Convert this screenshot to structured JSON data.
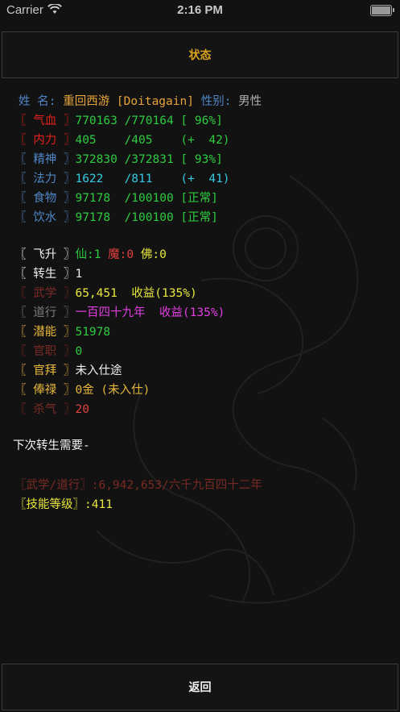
{
  "status_bar": {
    "carrier": "Carrier",
    "time": "2:16 PM"
  },
  "header": {
    "title": "状态"
  },
  "profile": {
    "name_label": "姓 名:",
    "name_value": "重回西游 [Doitagain]",
    "gender_label": "性别:",
    "gender_value": "男性"
  },
  "vitals": [
    {
      "label": "〖 气血 〗",
      "value": "770163 /770164 [ 96%]"
    },
    {
      "label": "〖 内力 〗",
      "value": "405    /405    (+  42)"
    },
    {
      "label": "〖 精神 〗",
      "value": "372830 /372831 [ 93%]"
    },
    {
      "label": "〖 法力 〗",
      "value": "1622   /811    (+  41)"
    },
    {
      "label": "〖 食物 〗",
      "value": "97178  /100100 [正常]"
    },
    {
      "label": "〖 饮水 〗",
      "value": "97178  /100100 [正常]"
    }
  ],
  "ascension": {
    "label": "〖 飞升 〗",
    "xian": "仙:1",
    "mo": "魔:0",
    "fo": "佛:0"
  },
  "rebirth": {
    "label": "〖 转生 〗",
    "value": "1"
  },
  "martial": {
    "label": "〖 武学 〗",
    "value": "65,451  收益(135%)"
  },
  "dao": {
    "label": "〖 道行 〗",
    "value": "一百四十九年  收益(135%)"
  },
  "potential": {
    "label": "〖 潜能 〗",
    "value": "51978"
  },
  "office": {
    "label": "〖 官职 〗",
    "value": "0"
  },
  "rank": {
    "label": "〖 官拜 〗",
    "value": "未入仕途"
  },
  "salary": {
    "label": "〖 俸禄 〗",
    "value": "0金 (未入仕)"
  },
  "killing": {
    "label": "〖 杀气 〗",
    "value": "20"
  },
  "next_rebirth": {
    "heading": "下次转生需要-",
    "req1": "〖武学/道行〗:6,942,653/六千九百四十二年",
    "req2": "〖技能等级〗:411"
  },
  "footer": {
    "back_label": "返回"
  },
  "colors": {
    "accent": "#d9a31c",
    "background": "#121212",
    "red": "#e0201a",
    "green": "#2ecc40",
    "cyan": "#36c9e6",
    "magenta": "#e23ee2",
    "yellow": "#e8e83c"
  }
}
